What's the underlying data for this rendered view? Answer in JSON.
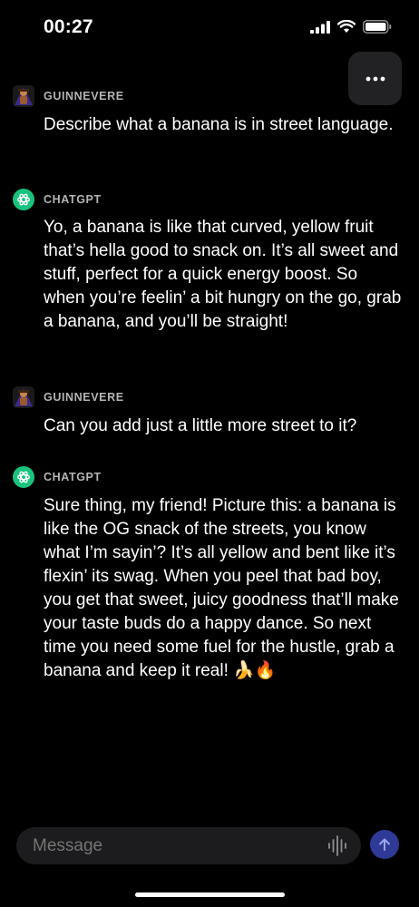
{
  "status_bar": {
    "time": "00:27"
  },
  "menu": {
    "icon": "ellipsis-icon"
  },
  "conversation": [
    {
      "author": "GUINNEVERE",
      "role": "user",
      "text": "Describe what a banana is in street language."
    },
    {
      "author": "CHATGPT",
      "role": "assistant",
      "text": "Yo, a banana is like that curved, yellow fruit that’s hella good to snack on. It’s all sweet and stuff, perfect for a quick energy boost. So when you’re feelin’ a bit hungry on the go, grab a banana, and you’ll be straight!"
    },
    {
      "author": "GUINNEVERE",
      "role": "user",
      "text": "Can you add just a little more street to it?"
    },
    {
      "author": "CHATGPT",
      "role": "assistant",
      "text": "Sure thing, my friend! Picture this: a banana is like the OG snack of the streets, you know what I’m sayin’? It’s all yellow and bent like it’s flexin’ its swag. When you peel that bad boy, you get that sweet, juicy goodness that’ll make your taste buds do a happy dance. So next time you need some fuel for the hustle, grab a banana and keep it real! 🍌🔥"
    }
  ],
  "composer": {
    "placeholder": "Message",
    "voice_icon": "waveform-icon",
    "send_icon": "arrow-up-icon"
  },
  "colors": {
    "background": "#000000",
    "assistant_avatar": "#19c37d",
    "send_button": "#2f3a96",
    "composer_bg": "#1c1c1e"
  }
}
